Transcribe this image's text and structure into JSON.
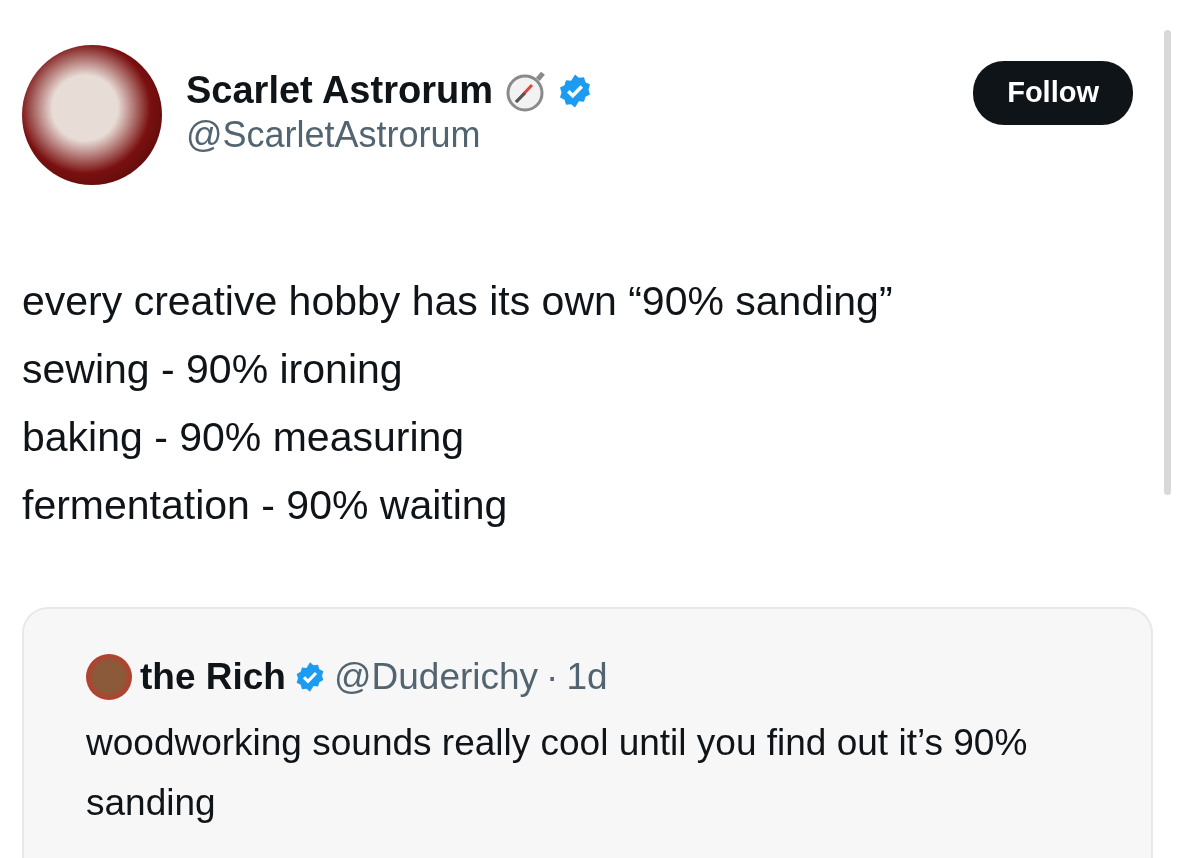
{
  "author": {
    "name": "Scarlet Astrorum",
    "handle": "@ScarletAstrorum",
    "verified": true
  },
  "follow_button": {
    "label": "Follow"
  },
  "tweet_lines": [
    "every creative hobby has its own “90% sanding”",
    "sewing - 90% ironing",
    "baking - 90% measuring",
    "fermentation - 90% waiting"
  ],
  "quoted_tweet": {
    "name": "the Rich",
    "verified": true,
    "handle": "@Duderichy",
    "separator": "·",
    "time": "1d",
    "text": "woodworking sounds really cool until you find out it’s 90% sanding"
  }
}
